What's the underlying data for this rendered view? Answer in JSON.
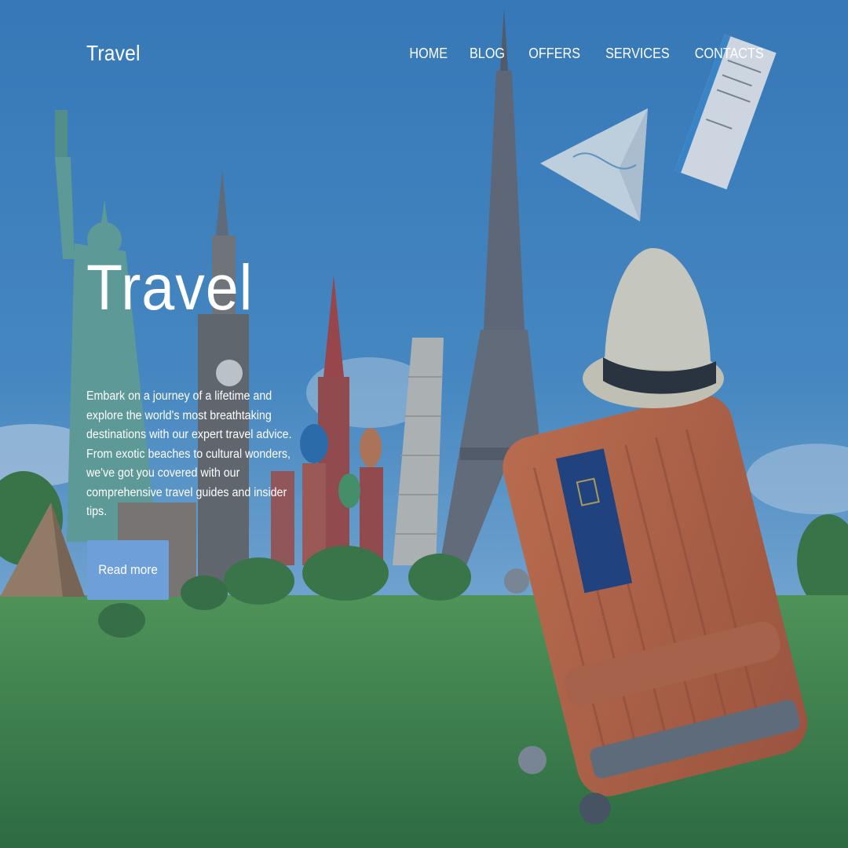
{
  "header": {
    "logo": "Travel",
    "nav": [
      "HOME",
      "BLOG",
      "OFFERS",
      "SERVICES",
      "CONTACTS"
    ]
  },
  "hero": {
    "title": "Travel",
    "text": "Embark on a journey of a lifetime and explore the world's most breathtaking destinations with our expert travel advice. From exotic beaches to cultural wonders, we've got you covered with our comprehensive travel guides and insider tips.",
    "button_label": "Read more"
  },
  "colors": {
    "button_bg": "#6f9fd8",
    "text": "#ffffff",
    "sky": "#3f86c4",
    "grass": "#3f8a37"
  }
}
